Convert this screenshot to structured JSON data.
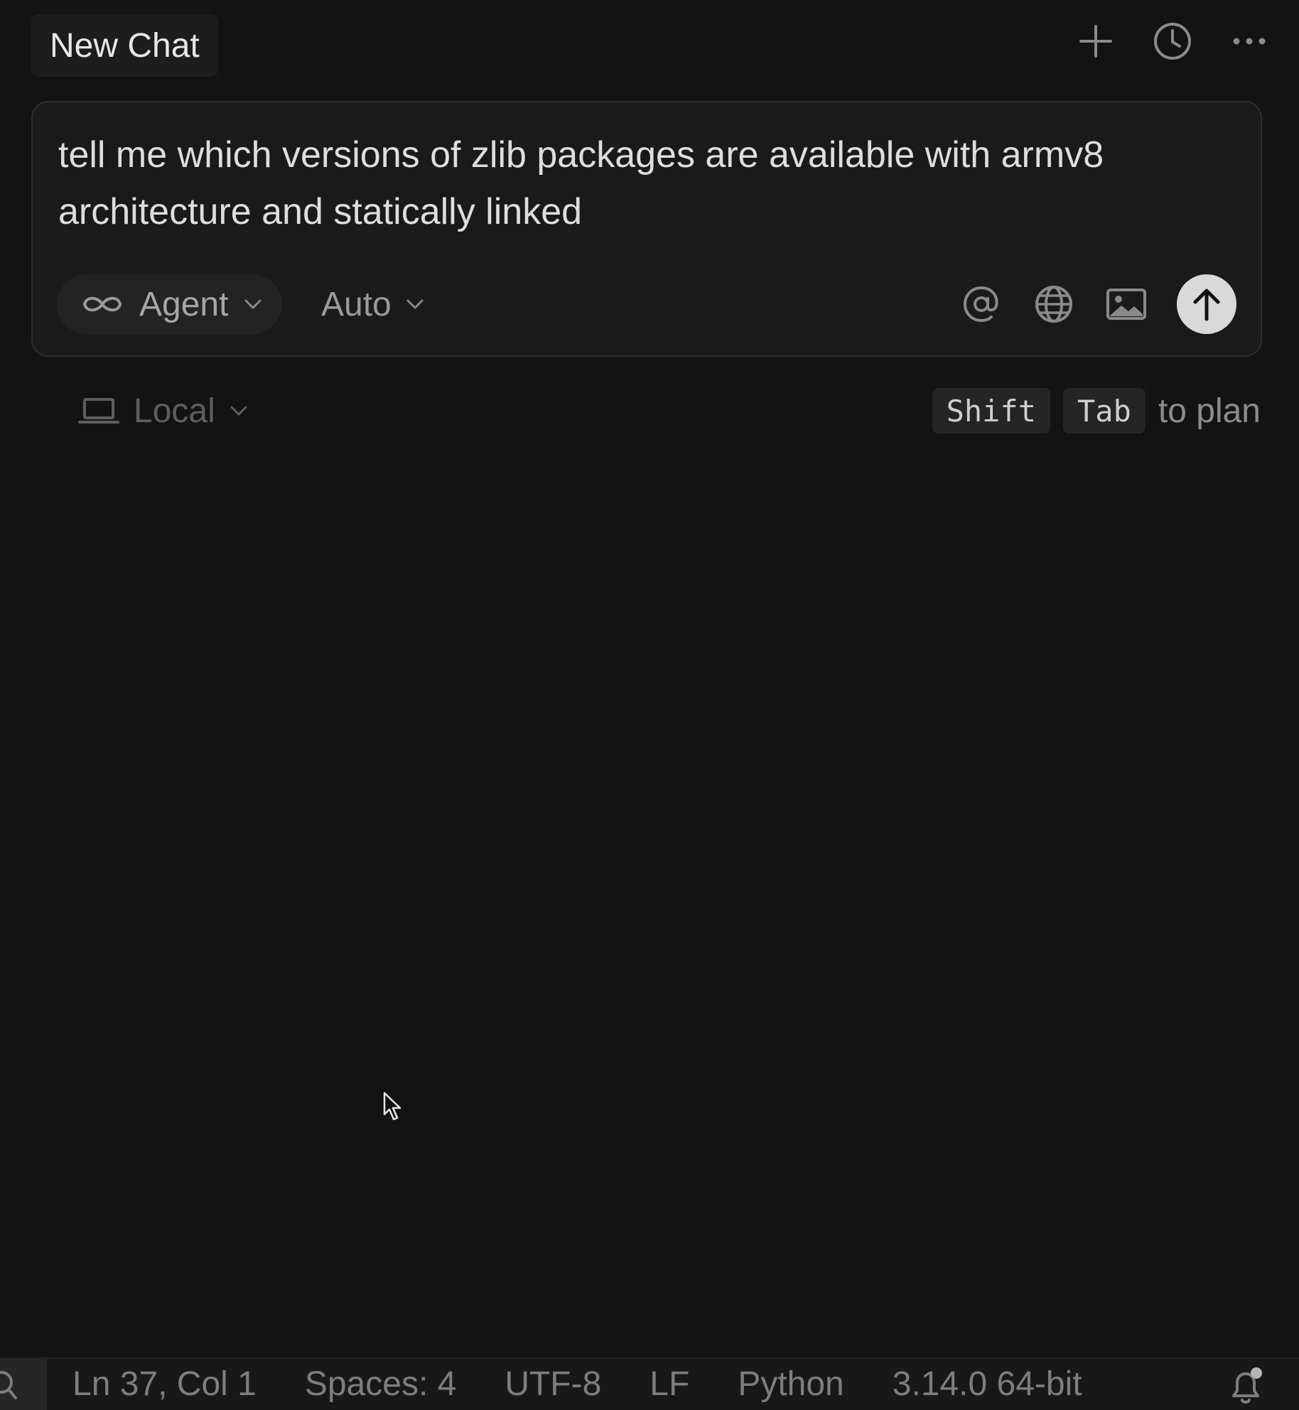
{
  "header": {
    "title": "New Chat",
    "actions": [
      {
        "icon": "plus-icon"
      },
      {
        "icon": "history-icon"
      },
      {
        "icon": "more-icon"
      }
    ]
  },
  "composer": {
    "prompt": "tell me which versions of zlib packages are available with armv8 architecture and statically linked",
    "mode": {
      "label": "Agent",
      "icon": "infinity-icon"
    },
    "model": {
      "label": "Auto"
    },
    "tools": [
      {
        "icon": "at-mention-icon"
      },
      {
        "icon": "globe-icon"
      },
      {
        "icon": "image-icon"
      }
    ],
    "send_icon": "arrow-up-icon"
  },
  "environment": {
    "label": "Local",
    "icon": "laptop-icon"
  },
  "plan_hint": {
    "key1": "Shift",
    "key2": "Tab",
    "text": "to plan"
  },
  "status_bar": {
    "position": "Ln 37, Col 1",
    "indent": "Spaces: 4",
    "encoding": "UTF-8",
    "eol": "LF",
    "language": "Python",
    "interpreter": "3.14.0 64-bit",
    "notification_icon": "bell-icon"
  },
  "colors": {
    "background": "#131313",
    "composer_bg": "#1a1a1a",
    "send_button": "#d9d9d9"
  }
}
